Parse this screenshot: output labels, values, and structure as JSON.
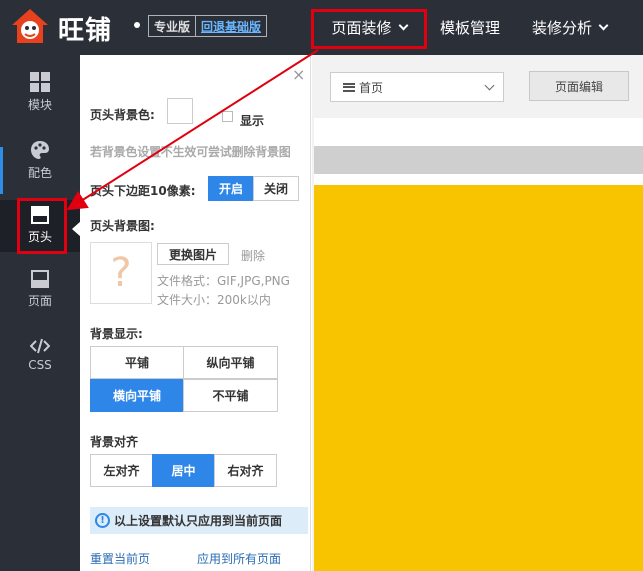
{
  "topbar": {
    "brand": "旺铺",
    "edition": "专业版",
    "downgrade": "回退基础版",
    "nav": [
      {
        "label": "页面装修",
        "dropdown": true
      },
      {
        "label": "模板管理",
        "dropdown": false
      },
      {
        "label": "装修分析",
        "dropdown": true
      }
    ]
  },
  "sidebar": {
    "items": [
      {
        "label": "模块",
        "icon": "grid-icon"
      },
      {
        "label": "配色",
        "icon": "palette-icon"
      },
      {
        "label": "页头",
        "icon": "header-icon",
        "active": true
      },
      {
        "label": "页面",
        "icon": "page-icon"
      },
      {
        "label": "CSS",
        "icon": "code-icon"
      }
    ]
  },
  "panel": {
    "close": "×",
    "bg_color_label": "页头背景色:",
    "show_label": "显示",
    "bg_hint": "若背景色设置不生效可尝试删除背景图",
    "margin_label": "页头下边距10像素:",
    "toggle_on": "开启",
    "toggle_off": "关闭",
    "bg_image_label": "页头背景图:",
    "placeholder_glyph": "?",
    "change_image": "更换图片",
    "delete": "删除",
    "file_format": "文件格式：GIF,JPG,PNG",
    "file_size": "文件大小：200k以内",
    "display_label": "背景显示:",
    "display_options": [
      "平铺",
      "纵向平铺",
      "横向平铺",
      "不平铺"
    ],
    "display_selected": "横向平铺",
    "align_label": "背景对齐",
    "align_options": [
      "左对齐",
      "居中",
      "右对齐"
    ],
    "align_selected": "居中",
    "notice": "以上设置默认只应用到当前页面",
    "reset": "重置当前页",
    "apply_all": "应用到所有页面"
  },
  "preview": {
    "page_select": "首页",
    "edit_button": "页面编辑"
  },
  "colors": {
    "topbar_bg": "#2b2f38",
    "accent_blue": "#2e87e8",
    "annotation_red": "#e0000f",
    "preview_yellow": "#f8c400"
  }
}
